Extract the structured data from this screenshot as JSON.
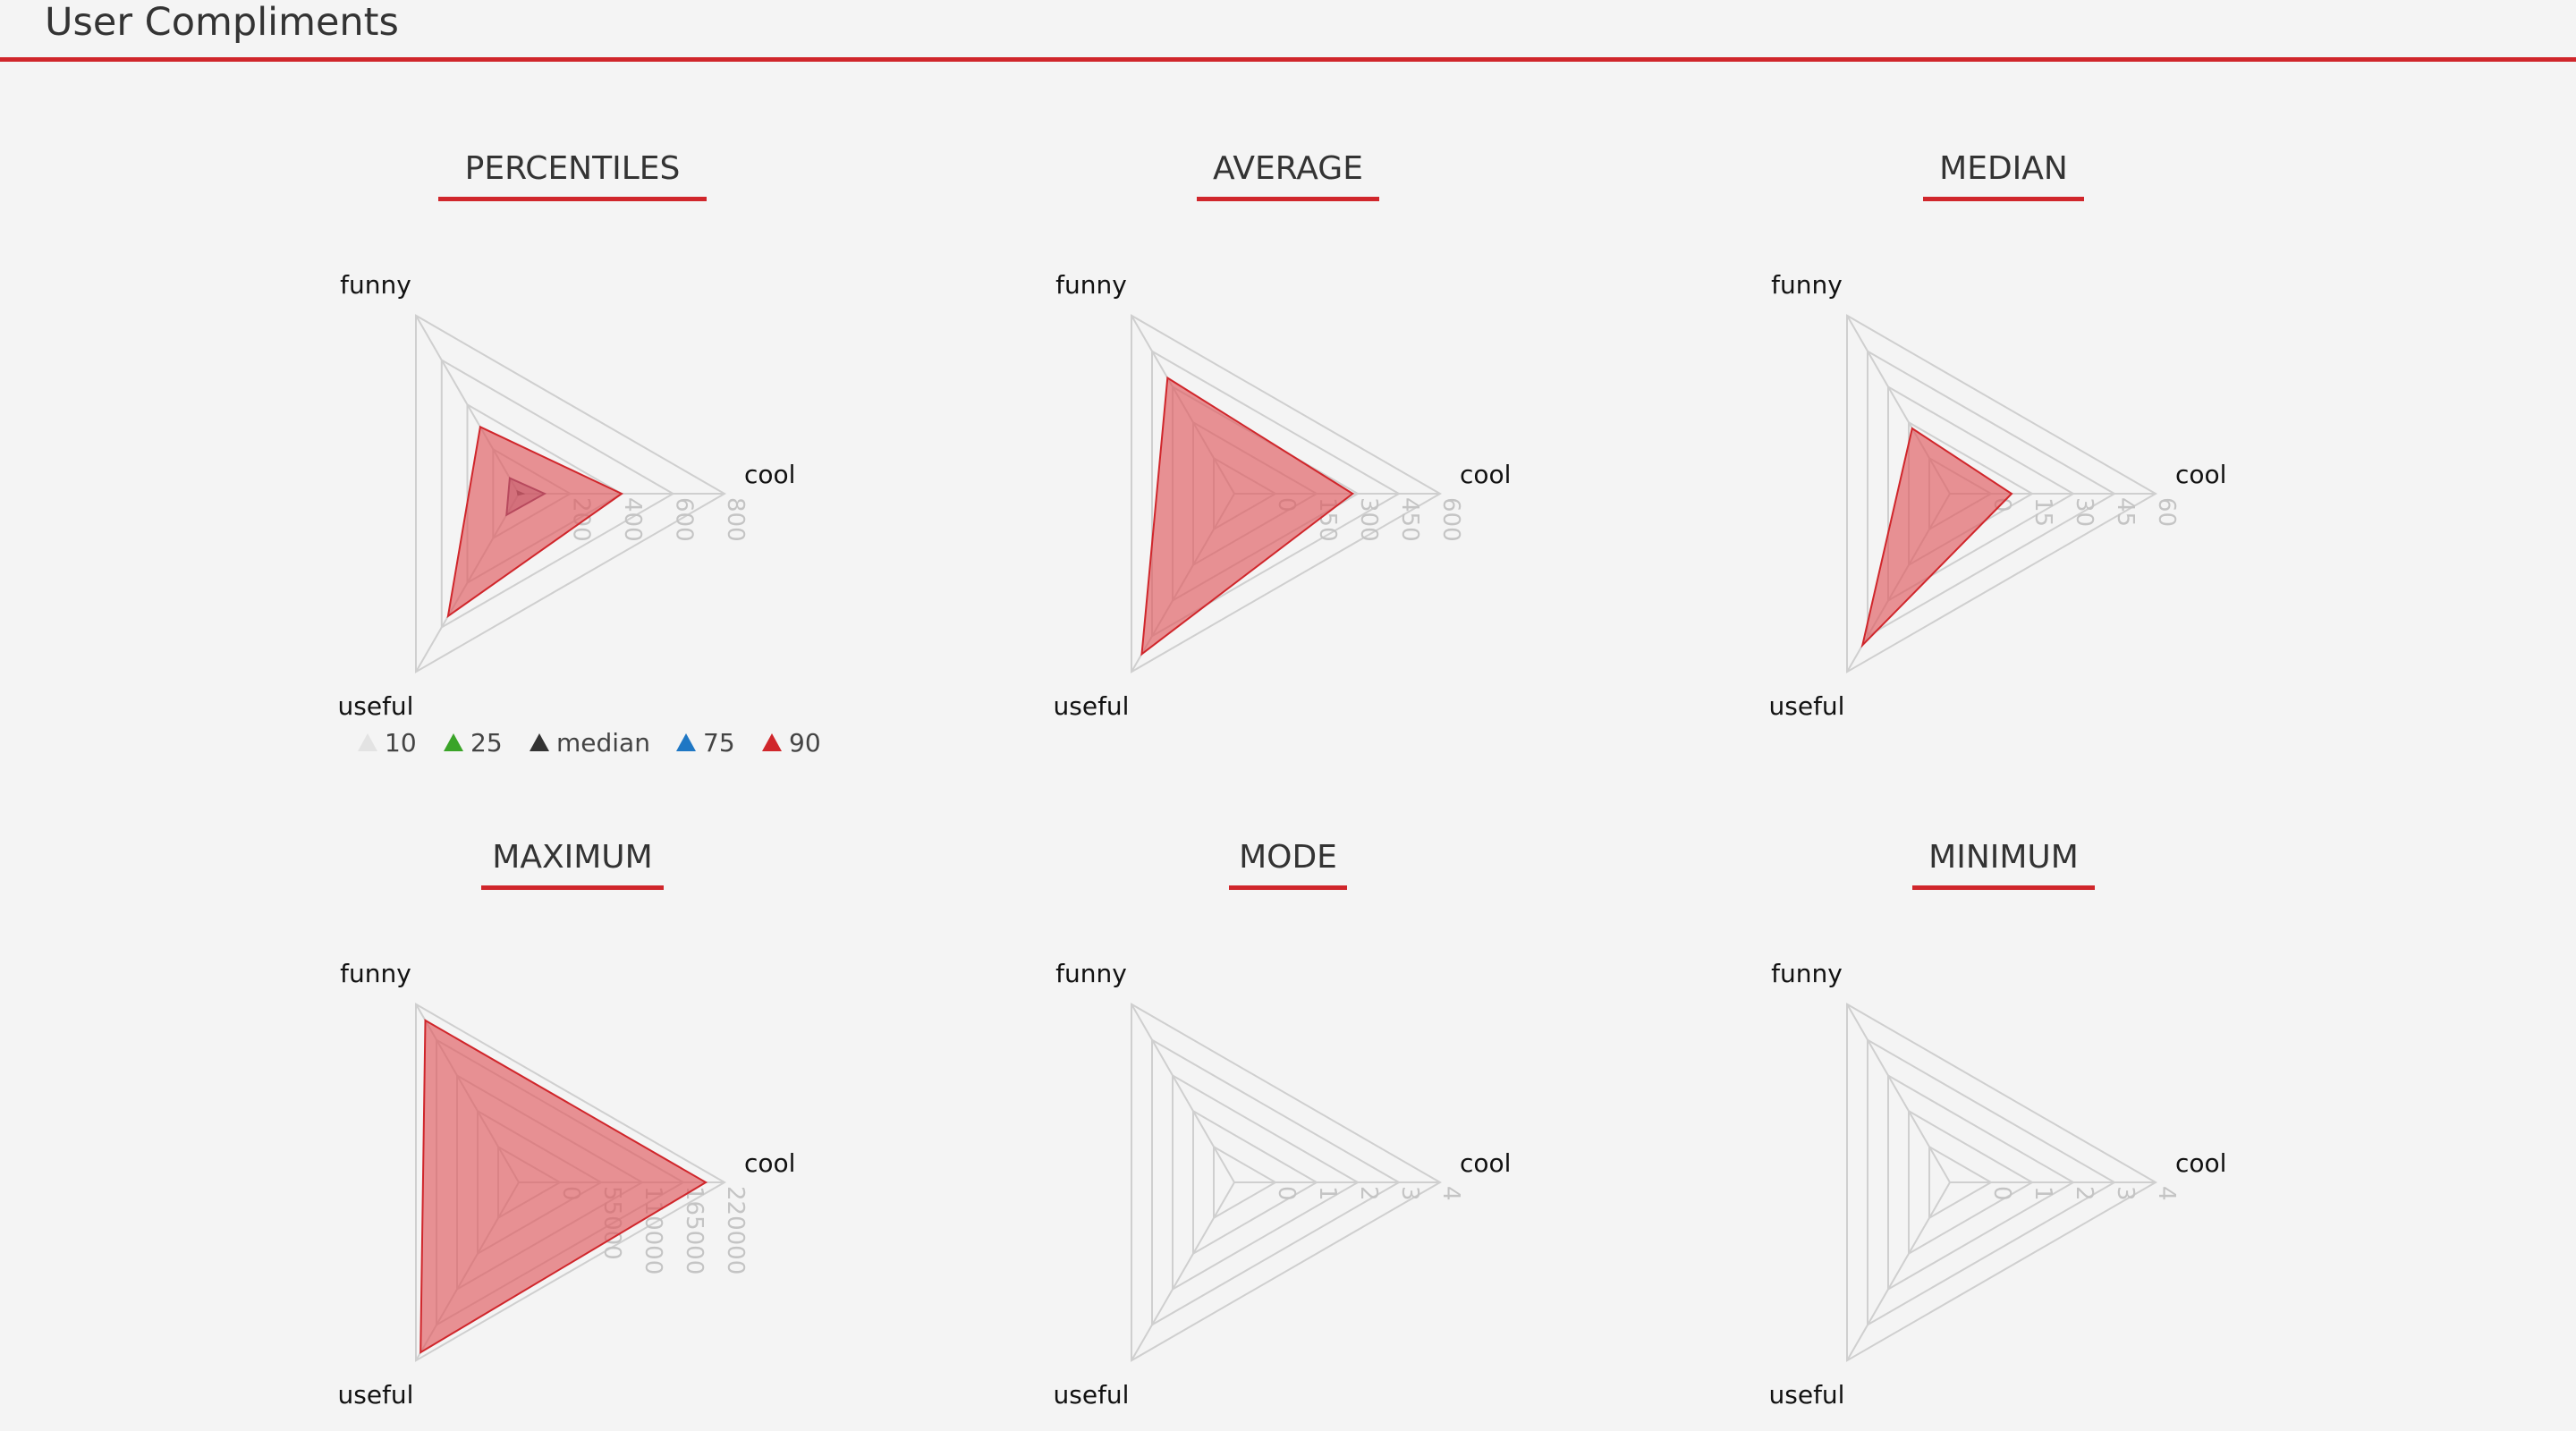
{
  "header": {
    "title": "User Compliments"
  },
  "colors": {
    "accent": "#d0262b",
    "fill": "#e05a60",
    "grid": "#cfcfcf",
    "tick": "#c4c4c4",
    "legend": {
      "10": "#e3e3e3",
      "25": "#3aa428",
      "median": "#333333",
      "75": "#1f77c4",
      "90": "#d0262b"
    }
  },
  "chart_data": [
    {
      "type": "radar",
      "title": "PERCENTILES",
      "axes": [
        "funny",
        "cool",
        "useful"
      ],
      "ticks": [
        "200",
        "400",
        "600",
        "800"
      ],
      "max": 800,
      "legend": [
        "10",
        "25",
        "median",
        "75",
        "90"
      ],
      "legend_placement": "bottom",
      "series": [
        {
          "name": "10",
          "values": [
            0,
            0,
            0
          ]
        },
        {
          "name": "25",
          "values": [
            0,
            0,
            0
          ]
        },
        {
          "name": "median",
          "values": [
            10,
            15,
            5
          ]
        },
        {
          "name": "75",
          "values": [
            70,
            100,
            95
          ]
        },
        {
          "name": "90",
          "values": [
            300,
            400,
            550
          ]
        }
      ]
    },
    {
      "type": "radar",
      "title": "AVERAGE",
      "axes": [
        "funny",
        "cool",
        "useful"
      ],
      "ticks": [
        "0",
        "150",
        "300",
        "450",
        "600"
      ],
      "max": 600,
      "series": [
        {
          "values": [
            390,
            345,
            540
          ]
        }
      ]
    },
    {
      "type": "radar",
      "title": "MEDIAN",
      "axes": [
        "funny",
        "cool",
        "useful"
      ],
      "ticks": [
        "0",
        "15",
        "30",
        "45",
        "60"
      ],
      "max": 60,
      "series": [
        {
          "values": [
            22,
            18,
            51
          ]
        }
      ]
    },
    {
      "type": "radar",
      "title": "MAXIMUM",
      "axes": [
        "funny",
        "cool",
        "useful"
      ],
      "ticks": [
        "0",
        "55000",
        "110000",
        "165000",
        "220000"
      ],
      "max": 220000,
      "series": [
        {
          "values": [
            200000,
            200000,
            210000
          ]
        }
      ]
    },
    {
      "type": "radar",
      "title": "MODE",
      "axes": [
        "funny",
        "cool",
        "useful"
      ],
      "ticks": [
        "0",
        "1",
        "2",
        "3",
        "4"
      ],
      "max": 4,
      "series": []
    },
    {
      "type": "radar",
      "title": "MINIMUM",
      "axes": [
        "funny",
        "cool",
        "useful"
      ],
      "ticks": [
        "0",
        "1",
        "2",
        "3",
        "4"
      ],
      "max": 4,
      "series": []
    }
  ]
}
